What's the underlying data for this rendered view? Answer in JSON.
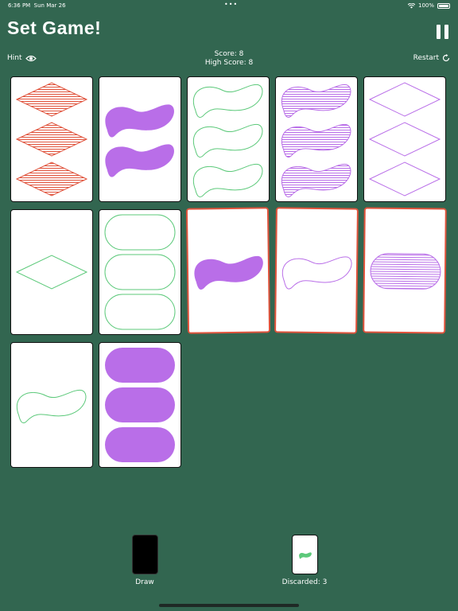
{
  "status_bar": {
    "time": "6:36 PM",
    "date": "Sun Mar 26",
    "battery": "100%"
  },
  "header": {
    "title": "Set Game!",
    "pause_icon": "pause-icon"
  },
  "toolbar": {
    "hint_label": "Hint",
    "score_label": "Score:  8",
    "high_score_label": "High Score: 8",
    "restart_label": "Restart"
  },
  "colors": {
    "background": "#326650",
    "red": "#e0533c",
    "purple": "#b96ee8",
    "green": "#5cc97a",
    "selected_border": "#e0533c"
  },
  "cards": [
    {
      "shape": "diamond",
      "color": "red",
      "shading": "striped",
      "count": 3,
      "selected": false
    },
    {
      "shape": "squiggle",
      "color": "purple",
      "shading": "solid",
      "count": 2,
      "selected": false
    },
    {
      "shape": "squiggle",
      "color": "green",
      "shading": "open",
      "count": 3,
      "selected": false
    },
    {
      "shape": "squiggle",
      "color": "purple",
      "shading": "striped",
      "count": 3,
      "selected": false
    },
    {
      "shape": "diamond",
      "color": "purple",
      "shading": "open",
      "count": 3,
      "selected": false
    },
    {
      "shape": "diamond",
      "color": "green",
      "shading": "open",
      "count": 1,
      "selected": false
    },
    {
      "shape": "oval",
      "color": "green",
      "shading": "open",
      "count": 3,
      "selected": false
    },
    {
      "shape": "squiggle",
      "color": "purple",
      "shading": "solid",
      "count": 1,
      "selected": true
    },
    {
      "shape": "squiggle",
      "color": "purple",
      "shading": "open",
      "count": 1,
      "selected": true
    },
    {
      "shape": "oval",
      "color": "purple",
      "shading": "striped",
      "count": 1,
      "selected": true
    },
    {
      "shape": "squiggle",
      "color": "green",
      "shading": "open",
      "count": 1,
      "selected": false
    },
    {
      "shape": "oval",
      "color": "purple",
      "shading": "solid",
      "count": 3,
      "selected": false
    }
  ],
  "piles": {
    "draw_label": "Draw",
    "discard_label": "Discarded: 3",
    "discard_top": {
      "shape": "squiggle",
      "color": "green",
      "shading": "solid",
      "count": 1
    }
  }
}
